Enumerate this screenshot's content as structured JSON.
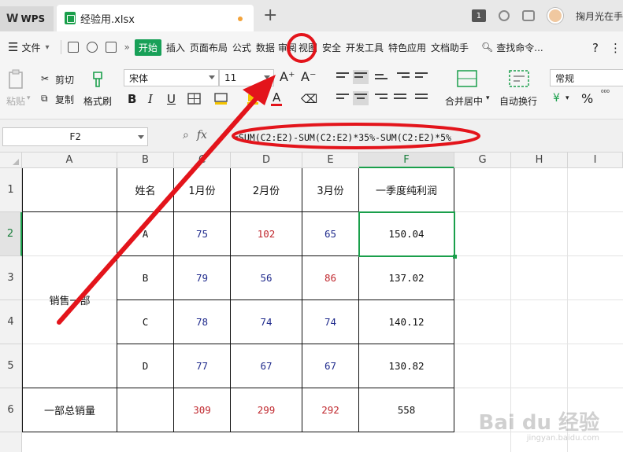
{
  "titlebar": {
    "app_label": "WPS",
    "file_tab": "经验用.xlsx",
    "new_tab": "+",
    "tab_count": "1",
    "user_name": "掬月光在手"
  },
  "menu": {
    "file": "文件",
    "items": [
      "开始",
      "插入",
      "页面布局",
      "公式",
      "数据",
      "审阅",
      "视图",
      "安全",
      "开发工具",
      "特色应用",
      "文档助手"
    ],
    "search": "查找命令...",
    "help": "?",
    "more": "⋮"
  },
  "ribbon": {
    "paste": "粘贴",
    "cut": "剪切",
    "copy": "复制",
    "format_painter": "格式刷",
    "font_name": "宋体",
    "font_size": "11",
    "bold": "B",
    "italic": "I",
    "underline": "U",
    "font_color_letter": "A",
    "merge_center": "合并居中",
    "wrap_text": "自动换行",
    "number_format": "常规",
    "percent": "%"
  },
  "formula_bar": {
    "name_box": "F2",
    "fx_label": "fx",
    "formula": "=SUM(C2:E2)-SUM(C2:E2)*35%-SUM(C2:E2)*5%"
  },
  "sheet": {
    "columns": [
      "A",
      "B",
      "C",
      "D",
      "E",
      "F",
      "G",
      "H",
      "I"
    ],
    "rows": [
      "1",
      "2",
      "3",
      "4",
      "5",
      "6"
    ],
    "header": {
      "name": "姓名",
      "m1": "1月份",
      "m2": "2月份",
      "m3": "3月份",
      "profit": "一季度纯利润"
    },
    "group": "销售一部",
    "data": [
      {
        "name": "A",
        "m1": "75",
        "m2": "102",
        "m3": "65",
        "profit": "150.04"
      },
      {
        "name": "B",
        "m1": "79",
        "m2": "56",
        "m3": "86",
        "profit": "137.02"
      },
      {
        "name": "C",
        "m1": "78",
        "m2": "74",
        "m3": "74",
        "profit": "140.12"
      },
      {
        "name": "D",
        "m1": "77",
        "m2": "67",
        "m3": "67",
        "profit": "130.82"
      }
    ],
    "total": {
      "label": "一部总销量",
      "m1": "309",
      "m2": "299",
      "m3": "292",
      "profit": "558"
    },
    "selected_cell": "F2"
  },
  "colors": {
    "accent_green": "#1a9f4b",
    "value_blue": "#1f2a8c",
    "value_red": "#c0282e",
    "annotation_red": "#e3141b"
  },
  "watermark": {
    "main": "Bai du 经验",
    "sub": "jingyan.baidu.com"
  }
}
